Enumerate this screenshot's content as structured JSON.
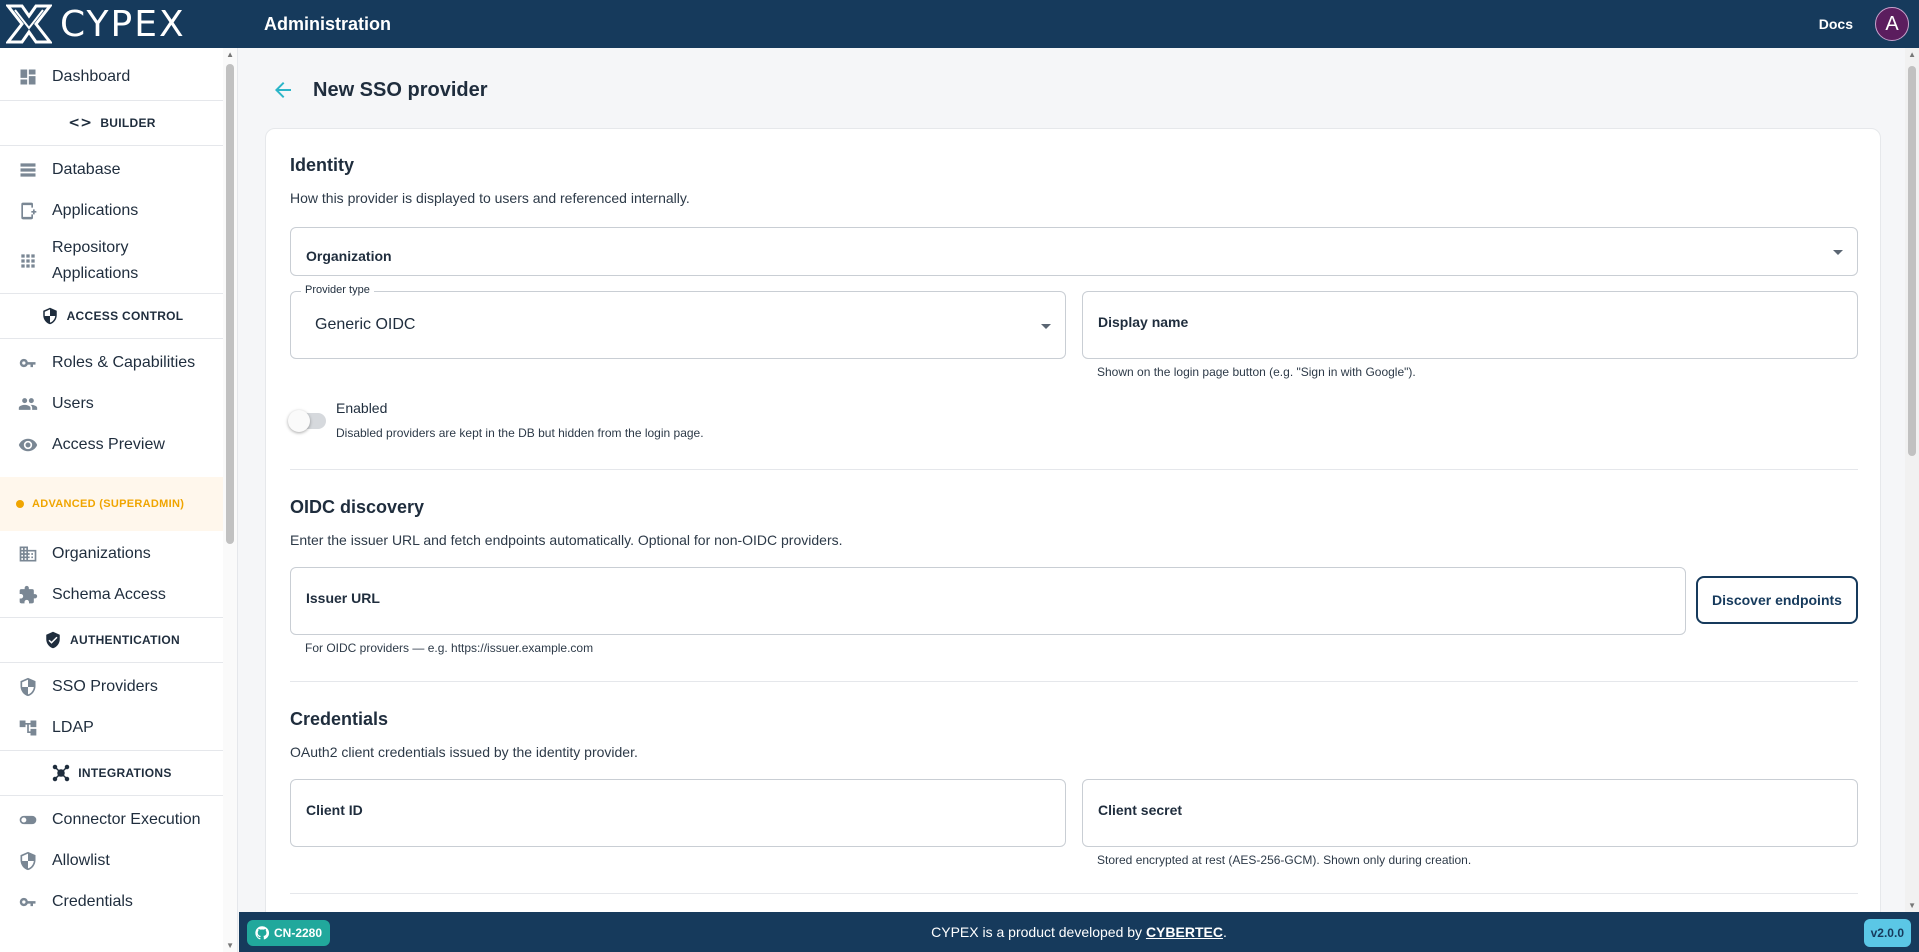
{
  "header": {
    "logo_text": "CYPEX",
    "title": "Administration",
    "docs_label": "Docs",
    "avatar_initial": "A"
  },
  "sidebar": {
    "items_top": [
      {
        "label": "Dashboard",
        "icon": "dashboard-icon"
      }
    ],
    "sections": {
      "builder": "BUILDER",
      "access_control": "ACCESS CONTROL",
      "advanced": "ADVANCED (SUPERADMIN)",
      "authentication": "AUTHENTICATION",
      "integrations": "INTEGRATIONS"
    },
    "builder_items": [
      {
        "label": "Database",
        "icon": "database-icon"
      },
      {
        "label": "Applications",
        "icon": "applications-icon"
      },
      {
        "label": "Repository Applications",
        "icon": "grid-icon"
      }
    ],
    "access_items": [
      {
        "label": "Roles & Capabilities",
        "icon": "key-icon"
      },
      {
        "label": "Users",
        "icon": "users-icon"
      },
      {
        "label": "Access Preview",
        "icon": "eye-icon"
      }
    ],
    "advanced_items": [
      {
        "label": "Organizations",
        "icon": "building-icon"
      },
      {
        "label": "Schema Access",
        "icon": "puzzle-icon"
      }
    ],
    "auth_items": [
      {
        "label": "SSO Providers",
        "icon": "shield-icon"
      },
      {
        "label": "LDAP",
        "icon": "tree-icon"
      }
    ],
    "integration_items": [
      {
        "label": "Connector Execution",
        "icon": "toggle-icon"
      },
      {
        "label": "Allowlist",
        "icon": "shield-icon"
      },
      {
        "label": "Credentials",
        "icon": "key-icon"
      }
    ]
  },
  "page": {
    "title": "New SSO provider"
  },
  "identity": {
    "title": "Identity",
    "description": "How this provider is displayed to users and referenced internally.",
    "organization_label": "Organization",
    "provider_type_label": "Provider type",
    "provider_type_value": "Generic OIDC",
    "display_name_label": "Display name",
    "display_name_helper": "Shown on the login page button (e.g. \"Sign in with Google\").",
    "enabled_label": "Enabled",
    "enabled_helper": "Disabled providers are kept in the DB but hidden from the login page.",
    "enabled": false
  },
  "oidc": {
    "title": "OIDC discovery",
    "description": "Enter the issuer URL and fetch endpoints automatically. Optional for non-OIDC providers.",
    "issuer_label": "Issuer URL",
    "issuer_helper": "For OIDC providers — e.g. https://issuer.example.com",
    "discover_button": "Discover endpoints"
  },
  "credentials": {
    "title": "Credentials",
    "description": "OAuth2 client credentials issued by the identity provider.",
    "client_id_label": "Client ID",
    "client_secret_label": "Client secret",
    "client_secret_helper": "Stored encrypted at rest (AES-256-GCM). Shown only during creation."
  },
  "footer": {
    "branch_badge": "CN-2280",
    "text_prefix": "CYPEX is a product developed by ",
    "company": "CYBERTEC",
    "text_suffix": ".",
    "version": "v2.0.0"
  },
  "colors": {
    "header_bg": "#163a5c",
    "accent_teal": "#2bb5c8",
    "advanced_orange": "#f0a500",
    "badge_green": "#21a89c",
    "version_badge": "#5bc7e6"
  }
}
